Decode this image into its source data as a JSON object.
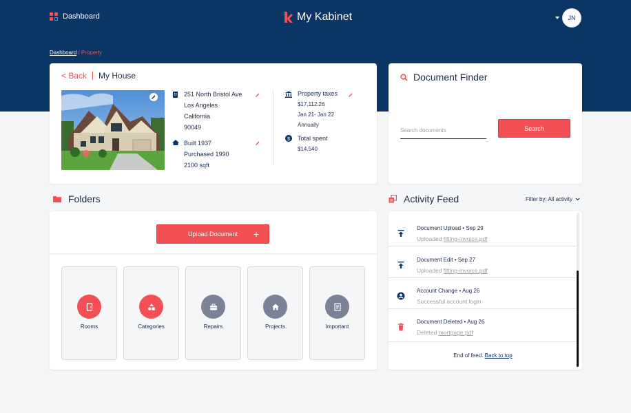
{
  "header": {
    "nav_label": "Dashboard",
    "brand": "My Kabinet",
    "user_initials": "JN"
  },
  "breadcrumb": {
    "home": "Dashboard",
    "separator": "/",
    "current": "Property"
  },
  "property": {
    "back_label": "< Back",
    "name": "My House",
    "address": [
      "251 North Bristol Ave",
      "Los Angeles",
      "California",
      "90049"
    ],
    "history": [
      "Built 1937",
      "Purchased 1990",
      "2100 sqft"
    ],
    "taxes_label": "Property taxes",
    "taxes_amount": "$17,112.26",
    "taxes_period": "Jan 21- Jan 22",
    "taxes_frequency": "Annually",
    "total_label": "Total spent",
    "total_amount": "$14,540"
  },
  "finder": {
    "title": "Document Finder",
    "placeholder": "Search documents",
    "button": "Search"
  },
  "folders": {
    "title": "Folders",
    "upload_label": "Upload Document",
    "tiles": [
      {
        "label": "Rooms",
        "icon": "door-icon",
        "color": "#f25054"
      },
      {
        "label": "Categories",
        "icon": "shapes-icon",
        "color": "#f25054"
      },
      {
        "label": "Repairs",
        "icon": "toolbox-icon",
        "color": "#7b8296"
      },
      {
        "label": "Projects",
        "icon": "house-icon",
        "color": "#7b8296"
      },
      {
        "label": "Important",
        "icon": "document-icon",
        "color": "#7b8296"
      }
    ]
  },
  "activity": {
    "title": "Activity Feed",
    "filter_label": "Filter by: All activity",
    "items": [
      {
        "title": "Document Upload • Sep 29",
        "sub": "Uploaded",
        "link": "fitting-invoice.pdf",
        "icon": "upload-icon"
      },
      {
        "title": "Document Edit • Sep 27",
        "sub": "Uploaded",
        "link": "fitting-invoice.pdf",
        "icon": "upload-icon"
      },
      {
        "title": "Account Change • Aug 26",
        "sub": "Successful account login",
        "link": "",
        "icon": "user-circle-icon"
      },
      {
        "title": "Document Deleted • Aug 26",
        "sub": "Deleted",
        "link": "mortgage.pdf",
        "icon": "trash-icon"
      }
    ],
    "end_text": "End of feed.",
    "back_to_top": "Back to top"
  },
  "colors": {
    "navy": "#0b3564",
    "accent": "#f25054",
    "gray_icon": "#7b8296"
  }
}
